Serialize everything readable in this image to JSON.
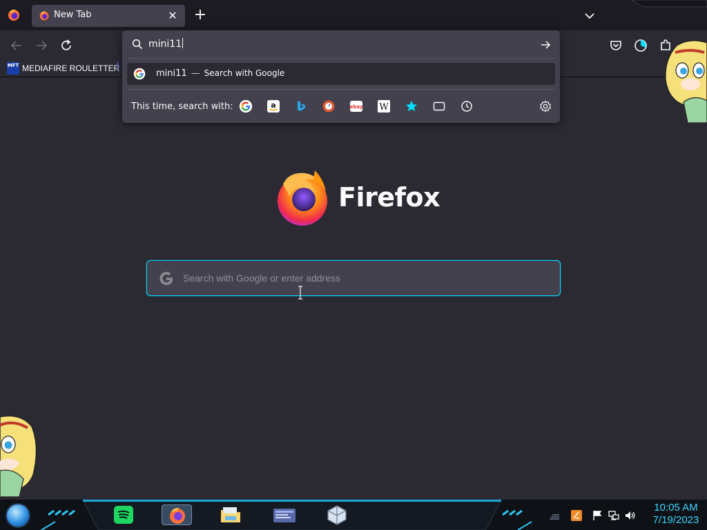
{
  "browser": {
    "tab": {
      "title": "New Tab"
    }
  },
  "urlbar": {
    "typed_text": "mini11",
    "suggestion": {
      "query": "mini11",
      "separator": "—",
      "action": "Search with Google"
    },
    "one_off_label": "This time, search with:",
    "one_off_engines": [
      "google-icon",
      "amazon-icon",
      "bing-icon",
      "duckduckgo-icon",
      "ebay-icon",
      "wikipedia-icon",
      "bookmarks-icon",
      "tabs-icon",
      "history-icon"
    ]
  },
  "bookmarks": [
    {
      "label": "MEDIAFIRE ROULETTER",
      "icon_text": "MFT"
    }
  ],
  "newtab": {
    "brand": "Firefox",
    "search_placeholder": "Search with Google or enter address"
  },
  "taskbar": {
    "apps": [
      "spotify-icon",
      "firefox-icon",
      "file-explorer-icon",
      "mail-icon",
      "virtualbox-icon"
    ],
    "active_app": "firefox-icon"
  },
  "clock": {
    "time": "10:05 AM",
    "date": "7/19/2023"
  },
  "colors": {
    "accent": "#00ddff",
    "toolbar_bg": "#2b2a33",
    "popup_bg": "#42414d",
    "clock": "#3ad6ff"
  }
}
